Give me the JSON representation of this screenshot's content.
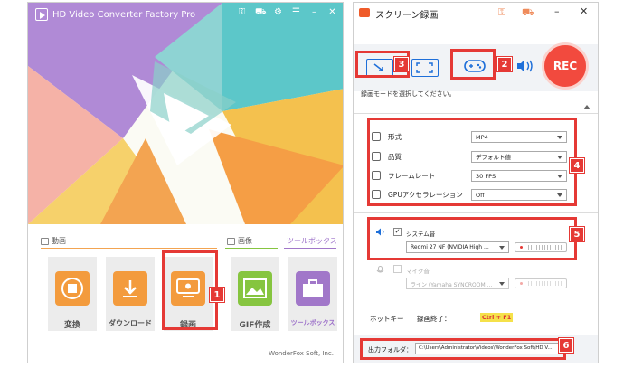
{
  "left_app": {
    "title": "HD Video Converter Factory Pro",
    "sections": {
      "video": "動画",
      "image": "画像",
      "toolbox": "ツールボックス"
    },
    "tiles": [
      {
        "label": "変換",
        "icon": "film-convert-icon",
        "color": "#f39b3d"
      },
      {
        "label": "ダウンロード",
        "icon": "download-icon",
        "color": "#f39b3d"
      },
      {
        "label": "録画",
        "icon": "screen-record-icon",
        "color": "#f39b3d"
      },
      {
        "label": "GIF作成",
        "icon": "image-icon",
        "color": "#86c540"
      },
      {
        "label": "ツールボックス",
        "icon": "toolbox-icon",
        "color": "#a177c9"
      }
    ],
    "footer": "WonderFox Soft, Inc."
  },
  "right_app": {
    "title": "スクリーン録画",
    "rec_button": "REC",
    "mode_hint": "録画モードを選択してください。",
    "settings": [
      {
        "label": "形式",
        "value": "MP4",
        "icon": "format-icon"
      },
      {
        "label": "品質",
        "value": "デフォルト値",
        "icon": "quality-icon"
      },
      {
        "label": "フレームレート",
        "value": "30 FPS",
        "icon": "framerate-icon"
      },
      {
        "label": "GPUアクセラレーション",
        "value": "Off",
        "icon": "gpu-icon"
      }
    ],
    "system_audio": {
      "label": "システム音",
      "checked": true,
      "device": "Redmi 27 NF (NVIDIA High ..."
    },
    "mic_audio": {
      "label": "マイク音",
      "checked": false,
      "device": "ライン (Yamaha SYNCROOM ..."
    },
    "hotkey_label": "ホットキー",
    "stop_label": "録画終了：",
    "stop_key": "Ctrl + F1",
    "output_label": "出力フォルダ：",
    "output_path": "C:\\Users\\Administrator\\Videos\\WonderFox Soft\\HD V..."
  },
  "annotations": [
    "1",
    "2",
    "3",
    "4",
    "5",
    "6"
  ],
  "colors": {
    "accent": "#e53935",
    "rec": "#f24a3e",
    "mode_blue": "#1e6fd9"
  }
}
